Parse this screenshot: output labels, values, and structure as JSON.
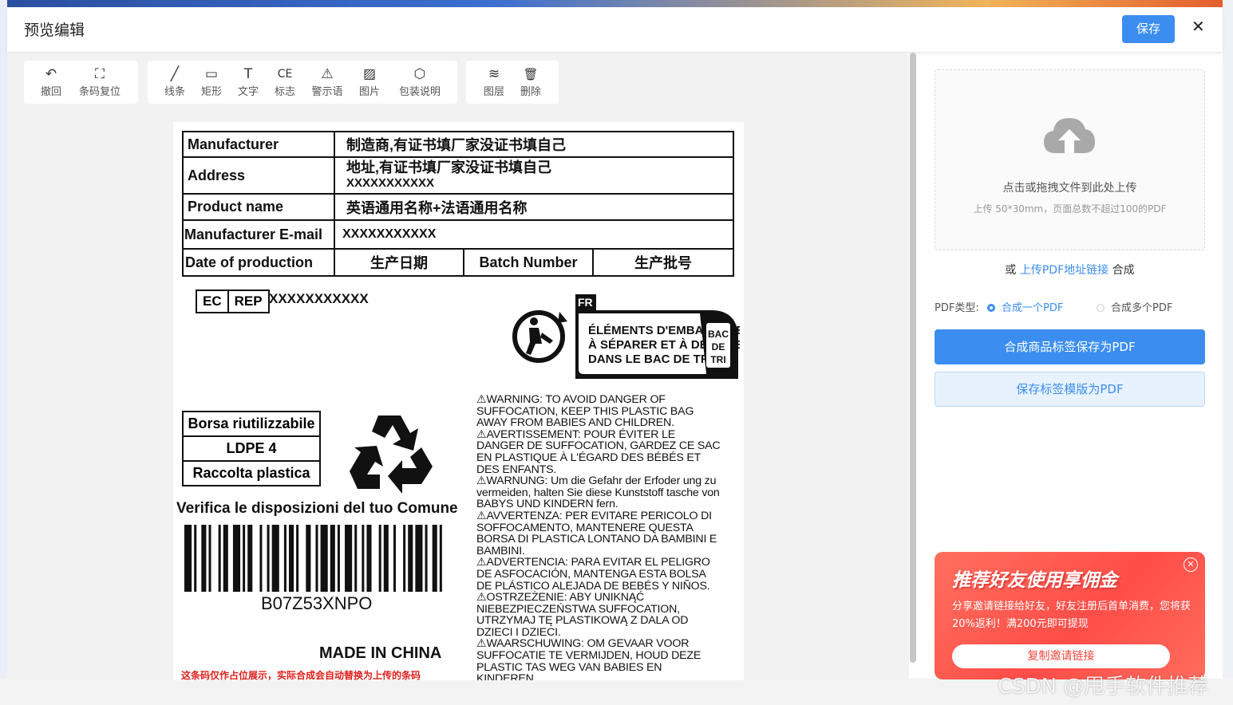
{
  "modal": {
    "title": "预览编辑",
    "save_label": "保存",
    "close_label": "✕"
  },
  "toolbar": {
    "group1": [
      {
        "icon": "undo-icon",
        "glyph": "↶",
        "label": "撤回"
      },
      {
        "icon": "barcode-reset-icon",
        "glyph": "⛶",
        "label": "条码复位"
      }
    ],
    "group2": [
      {
        "icon": "line-icon",
        "glyph": "╱",
        "label": "线条"
      },
      {
        "icon": "rectangle-icon",
        "glyph": "▭",
        "label": "矩形"
      },
      {
        "icon": "text-icon",
        "glyph": "T",
        "label": "文字"
      },
      {
        "icon": "ce-mark-icon",
        "glyph": "CE",
        "label": "标志"
      },
      {
        "icon": "warning-icon",
        "glyph": "⚠",
        "label": "警示语"
      },
      {
        "icon": "image-icon",
        "glyph": "▨",
        "label": "图片"
      },
      {
        "icon": "package-icon",
        "glyph": "⬡",
        "label": "包装说明"
      }
    ],
    "group3": [
      {
        "icon": "layers-icon",
        "glyph": "≋",
        "label": "图层"
      },
      {
        "icon": "trash-icon",
        "glyph": "🗑",
        "label": "删除"
      }
    ]
  },
  "label": {
    "rows": {
      "manufacturer_key": "Manufacturer",
      "manufacturer_val": "制造商,有证书填厂家没证书填自己",
      "address_key": "Address",
      "address_val1": "地址,有证书填厂家没证书填自己",
      "address_val2": "XXXXXXXXXXX",
      "product_key": "Product name",
      "product_val": "英语通用名称+法语通用名称",
      "email_key": "Manufacturer E-mail",
      "email_val": "XXXXXXXXXXX",
      "date_key": "Date of production",
      "date_val": "生产日期",
      "batch_key": "Batch Number",
      "batch_val": "生产批号"
    },
    "ec": "EC",
    "rep": "REP",
    "ec_rep_value": "XXXXXXXXXXX",
    "triman": {
      "fr": "FR",
      "line1": "ÉLÉMENTS D'EMBALLAGE",
      "line2": "À SÉPARER ET À DÉPOSER",
      "line3": "DANS LE BAC DE TRI",
      "bin1": "BAC",
      "bin2": "DE",
      "bin3": "TRI"
    },
    "borsa": [
      "Borsa riutilizzabile",
      "LDPE 4",
      "Raccolta plastica"
    ],
    "verifica": "Verifica le disposizioni del tuo Comune",
    "barcode_number": "B07Z53XNPO",
    "made_in": "MADE IN CHINA",
    "red_note": "这条码仅作占位展示，实际合成会自动替换为上传的条码",
    "warnings": [
      "⚠WARNING: TO AVOID DANGER OF",
      "SUFFOCATION, KEEP THIS PLASTIC BAG",
      "AWAY FROM BABIES AND CHILDREN.",
      "⚠AVERTISSEMENT: POUR ÉVITER LE",
      "DANGER DE SUFFOCATION, GARDEZ CE SAC",
      "EN PLASTIQUE À L'ÉGARD DES BÉBÉS ET",
      "DES ENFANTS.",
      "⚠WARNUNG: Um die Gefahr der Erfoder ung zu",
      "vermeiden, halten Sie diese Kunststoff tasche von",
      "BABYS UND KINDERN fern.",
      "⚠AVVERTENZA: PER EVITARE PERICOLO DI",
      "SOFFOCAMENTO, MANTENERE QUESTA",
      "BORSA DI PLASTICA LONTANO DA BAMBINI E",
      "BAMBINI.",
      "⚠ADVERTENCIA: PARA EVITAR EL PELIGRO",
      "DE ASFOCACIÓN, MANTENGA ESTA BOLSA",
      "DE PLÁSTICO ALEJADA DE BEBÉS Y NIÑOS.",
      "⚠OSTRZEŻENIE: ABY UNIKNĄĆ",
      "NIEBEZPIECZEŃSTWA SUFFOCATION,",
      "UTRZYMAJ TĘ PLASTIKOWĄ Z DALA OD",
      "DZIECI I DZIECI.",
      "⚠WAARSCHUWING: OM GEVAAR VOOR",
      "SUFFOCATIE TE VERMIJDEN, HOUD DEZE",
      "PLASTIC TAS WEG VAN BABIES EN",
      "KINDEREN."
    ]
  },
  "upload": {
    "main": "点击或拖拽文件到此处上传",
    "sub": "上传 50*30mm，页面总数不超过100的PDF",
    "or": "或",
    "link": "上传PDF地址链接",
    "suffix": "合成"
  },
  "pdf_type": {
    "label": "PDF类型:",
    "option1": "合成一个PDF",
    "option2": "合成多个PDF",
    "selected": "合成一个PDF"
  },
  "actions": {
    "primary": "合成商品标签保存为PDF",
    "secondary": "保存标签模版为PDF"
  },
  "promo": {
    "title": "推荐好友使用享佣金",
    "desc": "分享邀请链接给好友，好友注册后首单消费，您将获20%返利！满200元即可提现",
    "button": "复制邀请链接",
    "close": "✕"
  },
  "watermark": "CSDN @甩手软件推荐",
  "colors": {
    "accent": "#3b8ef0",
    "promo": "#ff4d48",
    "note_red": "#e0201c"
  }
}
